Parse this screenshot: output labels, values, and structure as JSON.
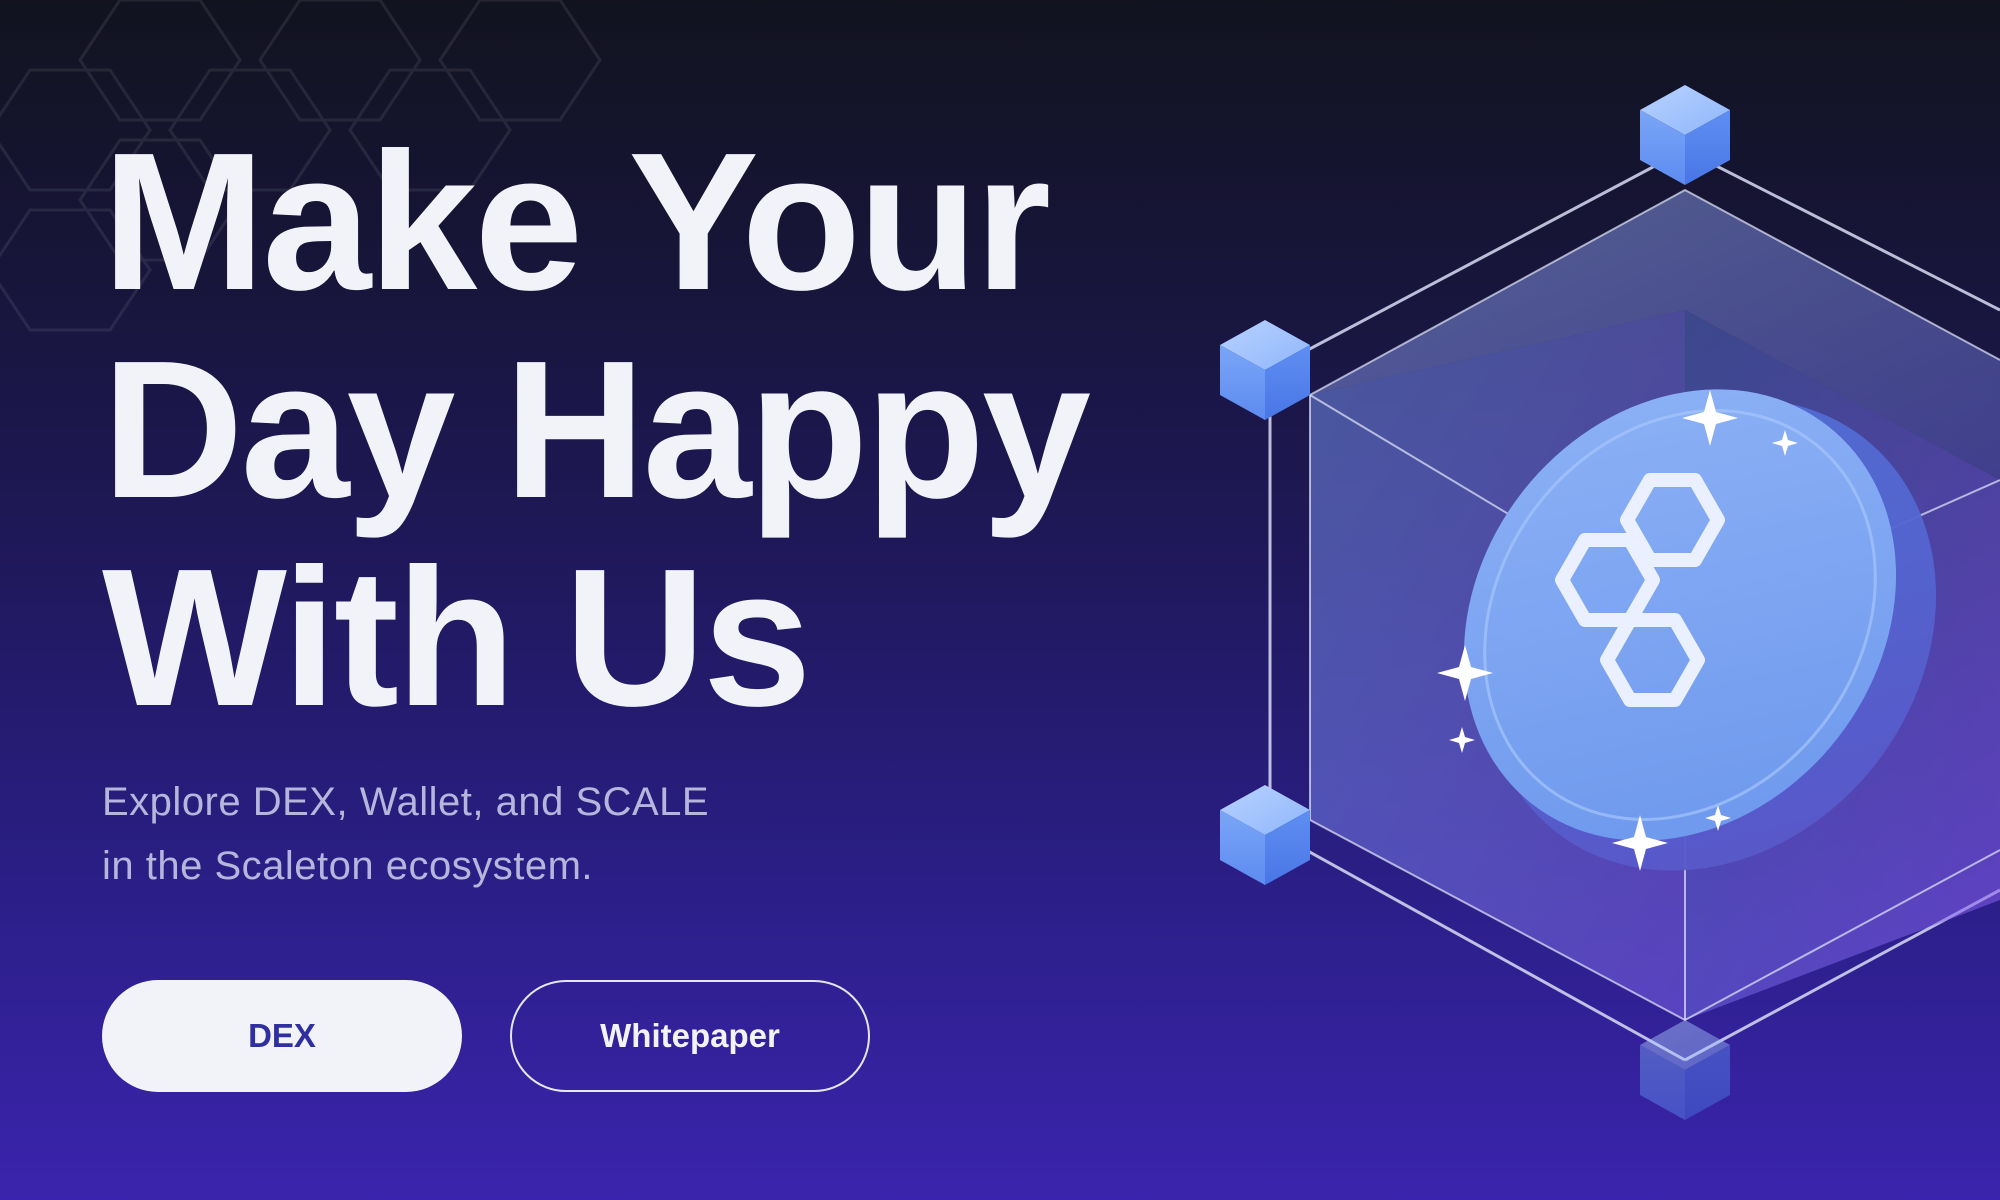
{
  "hero": {
    "headline": [
      "Make Your",
      "Day Happy",
      "With Us"
    ],
    "subtitle": [
      "Explore DEX, Wallet, and SCALE",
      "in the Scaleton ecosystem."
    ]
  },
  "buttons": {
    "dex": "DEX",
    "whitepaper": "Whitepaper"
  },
  "illustration": {
    "icon": "hexagon-cube-coin-logo"
  },
  "colors": {
    "background_top": "#12131f",
    "background_bottom": "#3a24ad",
    "headline": "#f2f3f8",
    "subtitle": "#b6b6dc",
    "dex_button_bg": "#f2f3f8",
    "dex_button_text": "#2f2fa0",
    "accent_blue": "#6f9cf0"
  }
}
